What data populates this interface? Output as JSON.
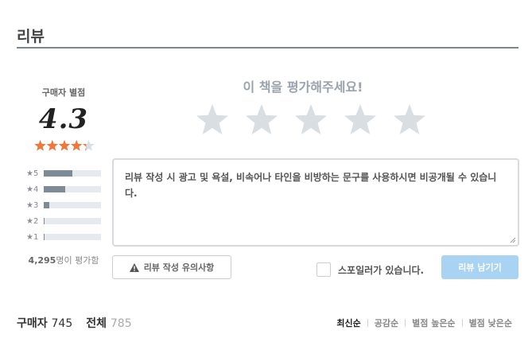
{
  "section": {
    "title": "리뷰"
  },
  "summary": {
    "label": "구매자 별점",
    "score": "4.3",
    "rating_fraction": 0.86,
    "distribution": [
      {
        "label": "5",
        "fraction": 0.5
      },
      {
        "label": "4",
        "fraction": 0.38
      },
      {
        "label": "3",
        "fraction": 0.1
      },
      {
        "label": "2",
        "fraction": 0.02
      },
      {
        "label": "1",
        "fraction": 0.02
      }
    ],
    "count": "4,295",
    "count_suffix": "명이 평가함"
  },
  "write": {
    "prompt": "이 책을 평가해주세요!",
    "star_count": 5,
    "review_placeholder": "리뷰 작성 시 광고 및 욕설, 비속어나 타인을 비방하는 문구를 사용하시면 비공개될 수 있습니다.",
    "guide_button": "리뷰 작성 유의사항",
    "spoiler_label": "스포일러가 있습니다.",
    "submit_button": "리뷰 남기기"
  },
  "tabs": [
    {
      "label": "구매자",
      "count": "745"
    },
    {
      "label": "전체",
      "count": "785"
    }
  ],
  "sorts": [
    "최신순",
    "공감순",
    "별점 높은순",
    "별점 낮은순"
  ],
  "colors": {
    "star_orange": "#f2763a",
    "star_empty": "#d9dee3",
    "bar_fill": "#7e8b97",
    "submit_bg": "#a9d3f2"
  },
  "icons": [
    "star-icon",
    "warning-icon",
    "resize-grip-icon"
  ]
}
